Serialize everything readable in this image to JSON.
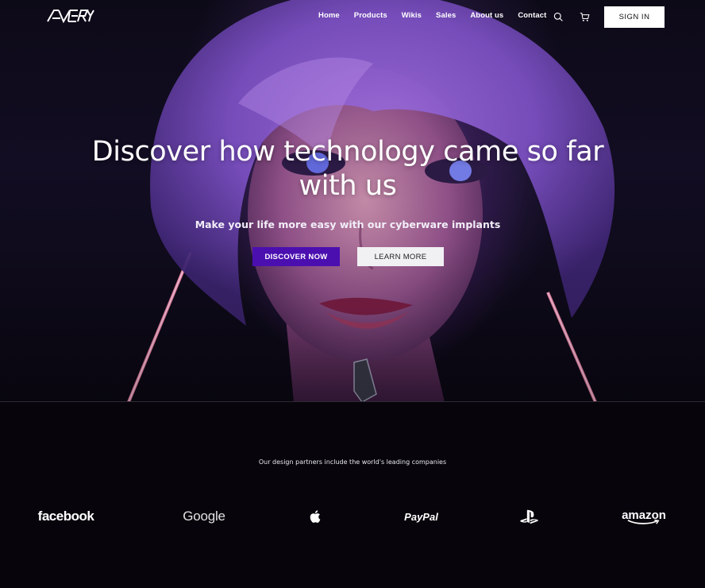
{
  "brand": {
    "logo_text": "AVERY"
  },
  "nav": {
    "items": [
      {
        "label": "Home"
      },
      {
        "label": "Products"
      },
      {
        "label": "Wikis"
      },
      {
        "label": "Sales"
      },
      {
        "label": "About us"
      },
      {
        "label": "Contact"
      }
    ],
    "search_icon": "search-icon",
    "cart_icon": "cart-icon",
    "signin_label": "SIGN IN"
  },
  "hero": {
    "headline": "Discover how technology came so far with us",
    "subline": "Make your life more easy with our cyberware implants",
    "primary_button": "DISCOVER NOW",
    "secondary_button": "LEARN MORE"
  },
  "partners": {
    "caption": "Our design partners include the world's leading companies",
    "logos": [
      {
        "name": "facebook"
      },
      {
        "name": "Google"
      },
      {
        "name": "apple-logo"
      },
      {
        "name": "PayPal"
      },
      {
        "name": "playstation-logo"
      },
      {
        "name": "amazon"
      }
    ]
  },
  "colors": {
    "primary_button": "#4b0fb0",
    "secondary_button": "#f1f0f3",
    "page_background": "#07050b",
    "hero_glow": "#a050a0",
    "neon_line": "#ff7fa8"
  }
}
